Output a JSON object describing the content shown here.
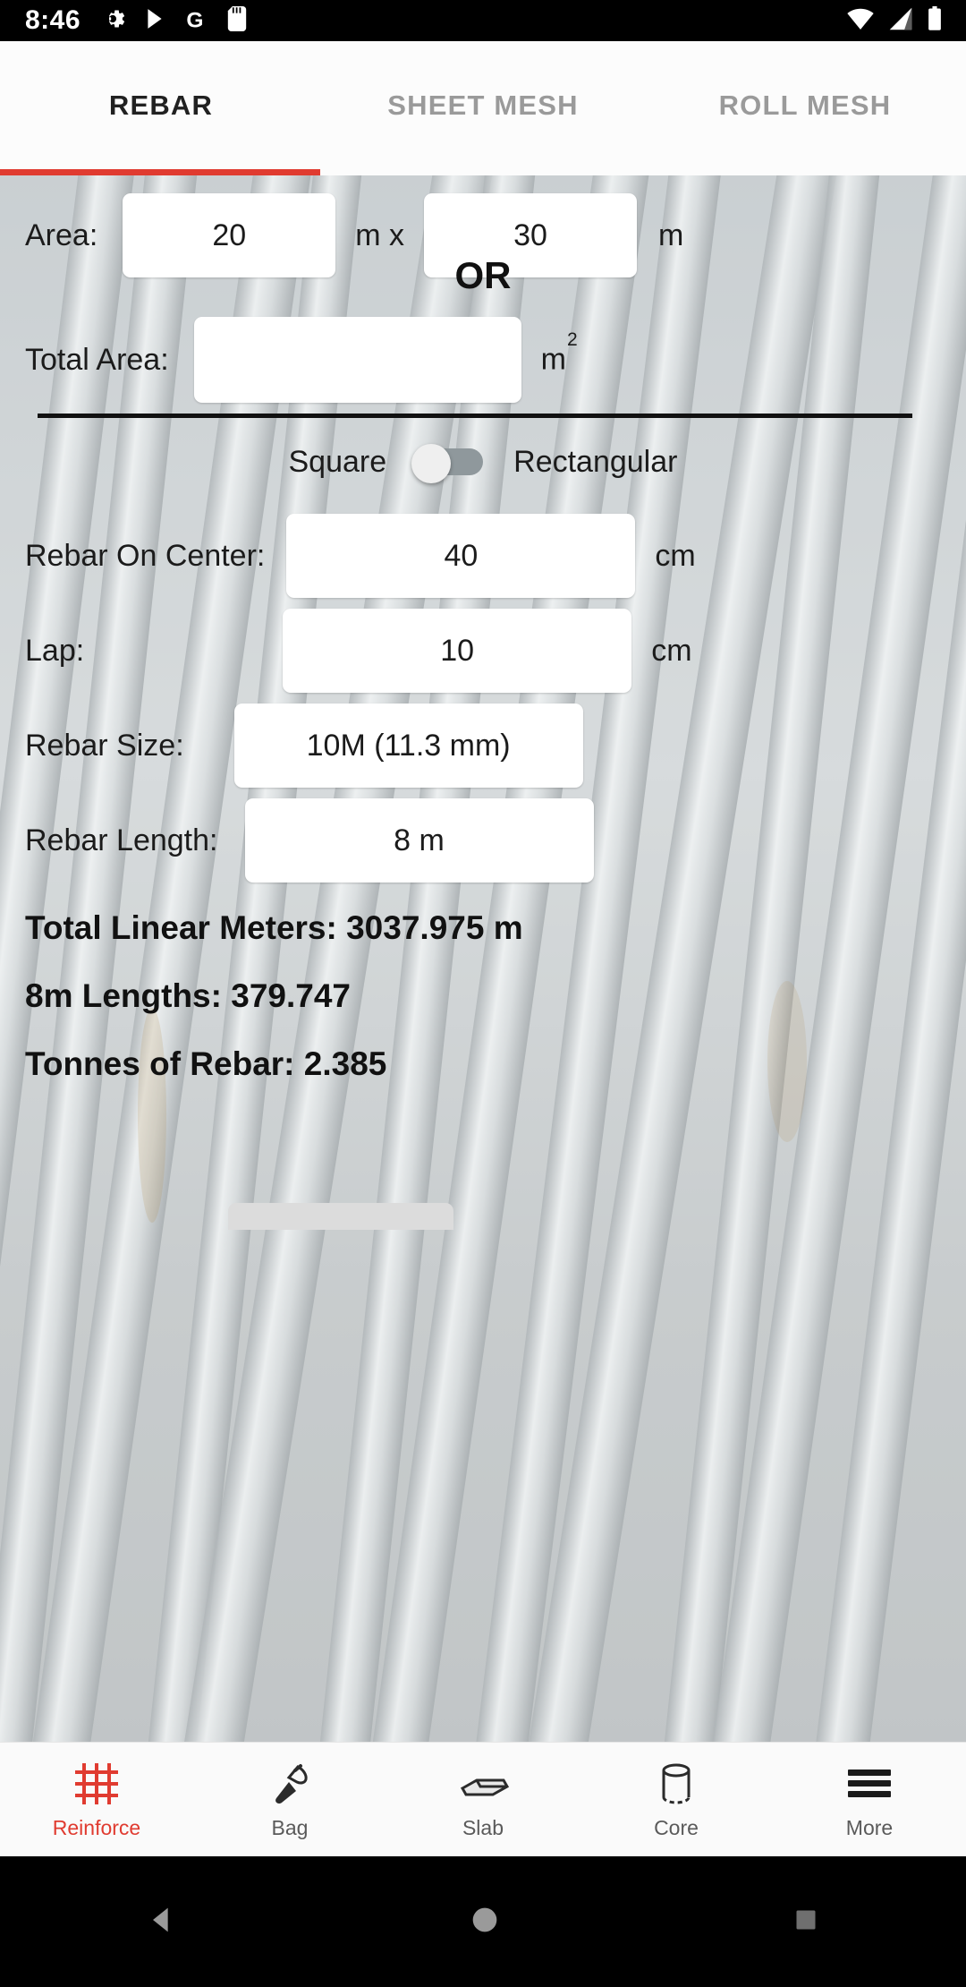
{
  "status_bar": {
    "time": "8:46",
    "left_icons": [
      "gear-icon",
      "play-store-icon",
      "google-g-icon",
      "sd-card-icon"
    ],
    "right_icons": [
      "wifi-icon",
      "cell-signal-icon",
      "battery-icon"
    ]
  },
  "tabs": [
    {
      "label": "REBAR",
      "active": true
    },
    {
      "label": "SHEET MESH",
      "active": false
    },
    {
      "label": "ROLL MESH",
      "active": false
    }
  ],
  "accent_color": "#e03b30",
  "form": {
    "area_label": "Area:",
    "area_width_value": "20",
    "area_width_unit": "m x",
    "area_length_value": "30",
    "area_length_unit": "m",
    "or_text": "OR",
    "total_area_label": "Total Area:",
    "total_area_value": "",
    "total_area_placeholder": "",
    "total_area_unit": "m",
    "total_area_unit_exponent": "2",
    "shape_left_label": "Square",
    "shape_right_label": "Rectangular",
    "shape_selected": "Square",
    "rebar_on_center_label": "Rebar On Center:",
    "rebar_on_center_value": "40",
    "rebar_on_center_unit": "cm",
    "lap_label": "Lap:",
    "lap_value": "10",
    "lap_unit": "cm",
    "rebar_size_label": "Rebar Size:",
    "rebar_size_value": "10M (11.3 mm)",
    "rebar_length_label": "Rebar Length:",
    "rebar_length_value": "8 m"
  },
  "results": [
    "Total Linear Meters: 3037.975 m",
    "8m Lengths: 379.747",
    "Tonnes of Rebar: 2.385"
  ],
  "bottom_nav": [
    {
      "label": "Reinforce",
      "icon": "rebar-grid-icon",
      "active": true
    },
    {
      "label": "Bag",
      "icon": "trowel-icon",
      "active": false
    },
    {
      "label": "Slab",
      "icon": "slab-icon",
      "active": false
    },
    {
      "label": "Core",
      "icon": "cylinder-icon",
      "active": false
    },
    {
      "label": "More",
      "icon": "hamburger-icon",
      "active": false
    }
  ],
  "system_nav": [
    "back-triangle-icon",
    "home-circle-icon",
    "recents-square-icon"
  ]
}
